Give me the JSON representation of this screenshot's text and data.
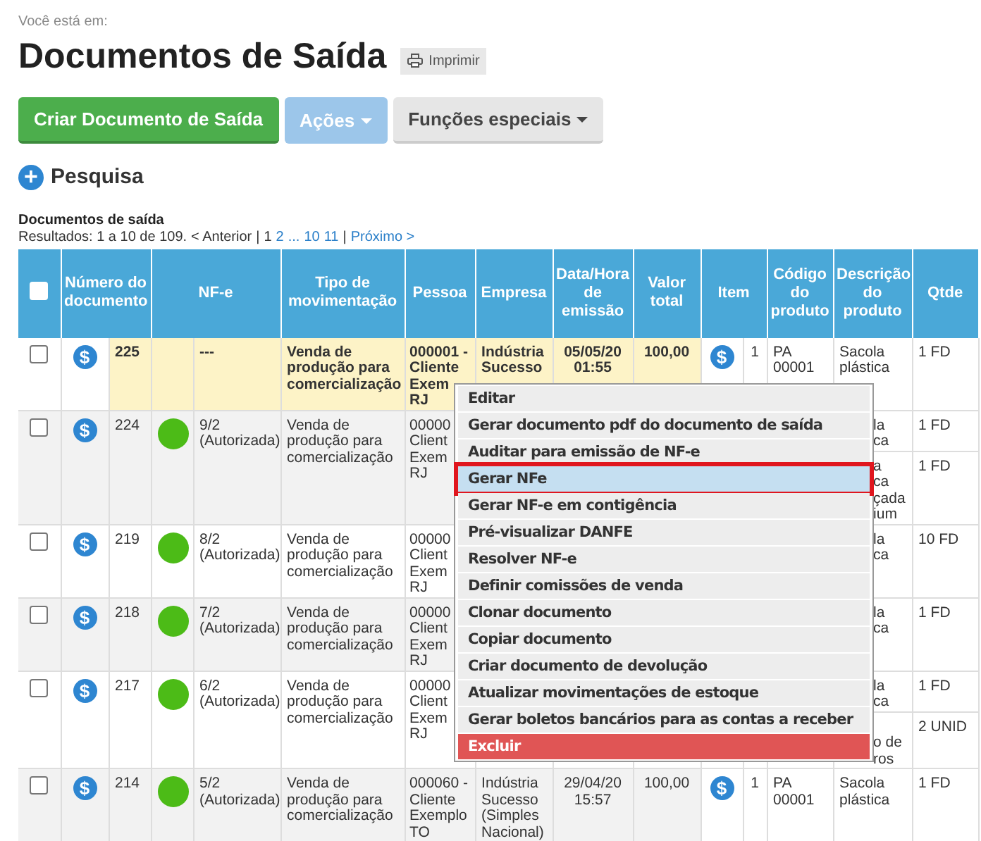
{
  "breadcrumb": "Você está em:",
  "title": "Documentos de Saída",
  "print_button": "Imprimir",
  "buttons": [
    {
      "label": "Criar Documento de Saída",
      "kind": "primary",
      "caret": false
    },
    {
      "label": "Ações",
      "kind": "disabled",
      "caret": true
    },
    {
      "label": "Funções especiais",
      "kind": "default",
      "caret": true
    }
  ],
  "search_toggle": {
    "icon": "+",
    "label": "Pesquisa"
  },
  "section_title": "Documentos de saída",
  "pagination": {
    "prefix": "Resultados: 1 a 10 de 109.",
    "previous": "< Anterior",
    "separator_1": "|",
    "pages": [
      {
        "label": "1",
        "selected": true
      },
      {
        "label": "2",
        "selected": false
      },
      {
        "label": "...",
        "selected": false
      },
      {
        "label": "10",
        "selected": false
      },
      {
        "label": "11",
        "selected": false
      }
    ],
    "separator_2": "|",
    "next": "Próximo >"
  },
  "table": {
    "select_all": {
      "checked": false
    },
    "columns": [
      "Número do documento",
      "NF-e",
      "Tipo de movimentação",
      "Pessoa",
      "Empresa",
      "Data/Hora de emissão",
      "Valor total",
      "Item",
      "Código do produto",
      "Descrição do produto",
      "Qtde"
    ],
    "rows": [
      {
        "checked": false,
        "payment_icon": "$",
        "number": "225",
        "highlighted": true,
        "nfe": {
          "text": "---"
        },
        "tipo": "Venda de produção para comercialização",
        "pessoa": "000001 -\nCliente\nExem\nRJ",
        "empresa": "Indústria\nSucesso",
        "data": "05/05/20 01:55",
        "valor": "100,00",
        "items": [
          {
            "icon": "$",
            "number": "1",
            "codigo": "PA 00001",
            "descricao": "Sacola plástica",
            "qtde": "1 FD"
          }
        ]
      },
      {
        "checked": false,
        "payment_icon": "$",
        "number": "224",
        "highlighted": false,
        "nfe": {
          "text": "9/2 (Autorizada)",
          "color": "#4cbb17"
        },
        "tipo": "Venda de produção para comercialização",
        "pessoa": "00000\nClient\nExem\nRJ",
        "items": [
          {
            "descricao": "la\nca",
            "qtde": "1 FD"
          },
          {
            "descricao": "a\nca\nçada\nium",
            "qtde": "1 FD"
          }
        ]
      },
      {
        "checked": false,
        "payment_icon": "$",
        "number": "219",
        "highlighted": false,
        "nfe": {
          "text": "8/2 (Autorizada)",
          "color": "#4cbb17"
        },
        "tipo": "Venda de produção para comercialização",
        "pessoa": "00000\nClient\nExem\nRJ",
        "items": [
          {
            "descricao": "la\nca",
            "qtde": "10 FD"
          }
        ]
      },
      {
        "checked": false,
        "payment_icon": "$",
        "number": "218",
        "highlighted": false,
        "nfe": {
          "text": "7/2 (Autorizada)",
          "color": "#4cbb17"
        },
        "tipo": "Venda de produção para comercialização",
        "pessoa": "00000\nClient\nExem\nRJ",
        "items": [
          {
            "descricao": "la\nca",
            "qtde": "1 FD"
          }
        ]
      },
      {
        "checked": false,
        "payment_icon": "$",
        "number": "217",
        "highlighted": false,
        "nfe": {
          "text": "6/2 (Autorizada)",
          "color": "#4cbb17"
        },
        "tipo": "Venda de produção para comercialização",
        "pessoa": "00000\nClient\nExem\nRJ",
        "items": [
          {
            "descricao": "la\nca",
            "qtde": "1 FD"
          },
          {
            "descricao": "\no de\nros",
            "qtde": "2 UNID"
          }
        ]
      },
      {
        "checked": false,
        "payment_icon": "$",
        "number": "214",
        "highlighted": false,
        "nfe": {
          "text": "5/2 (Autorizada)",
          "color": "#4cbb17"
        },
        "tipo": "Venda de produção para comercialização",
        "pessoa": "000060 - Cliente Exemplo TO",
        "empresa": "Indústria Sucesso (Simples Nacional)",
        "data": "29/04/20 15:57",
        "valor": "100,00",
        "items": [
          {
            "icon": "$",
            "number": "1",
            "codigo": "PA 00001",
            "descricao": "Sacola plástica",
            "qtde": "1 FD"
          }
        ]
      }
    ]
  },
  "context_menu": [
    {
      "label": "Editar",
      "kind": "normal",
      "selected": false
    },
    {
      "label": "Gerar documento pdf do documento de saída",
      "kind": "normal",
      "selected": false
    },
    {
      "label": "Auditar para emissão de NF-e",
      "kind": "normal",
      "selected": false
    },
    {
      "label": "Gerar NFe",
      "kind": "normal",
      "selected": true
    },
    {
      "label": "Gerar NF-e em contigência",
      "kind": "normal",
      "selected": false
    },
    {
      "label": "Pré-visualizar DANFE",
      "kind": "normal",
      "selected": false
    },
    {
      "label": "Resolver NF-e",
      "kind": "normal",
      "selected": false
    },
    {
      "label": "Definir comissões de venda",
      "kind": "normal",
      "selected": false
    },
    {
      "label": "Clonar documento",
      "kind": "normal",
      "selected": false
    },
    {
      "label": "Copiar documento",
      "kind": "normal",
      "selected": false
    },
    {
      "label": "Criar documento de devolução",
      "kind": "normal",
      "selected": false
    },
    {
      "label": "Atualizar movimentações de estoque",
      "kind": "normal",
      "selected": false
    },
    {
      "label": "Gerar boletos bancários para as contas a receber",
      "kind": "normal",
      "selected": false
    },
    {
      "label": "Excluir",
      "kind": "danger",
      "selected": false
    }
  ]
}
